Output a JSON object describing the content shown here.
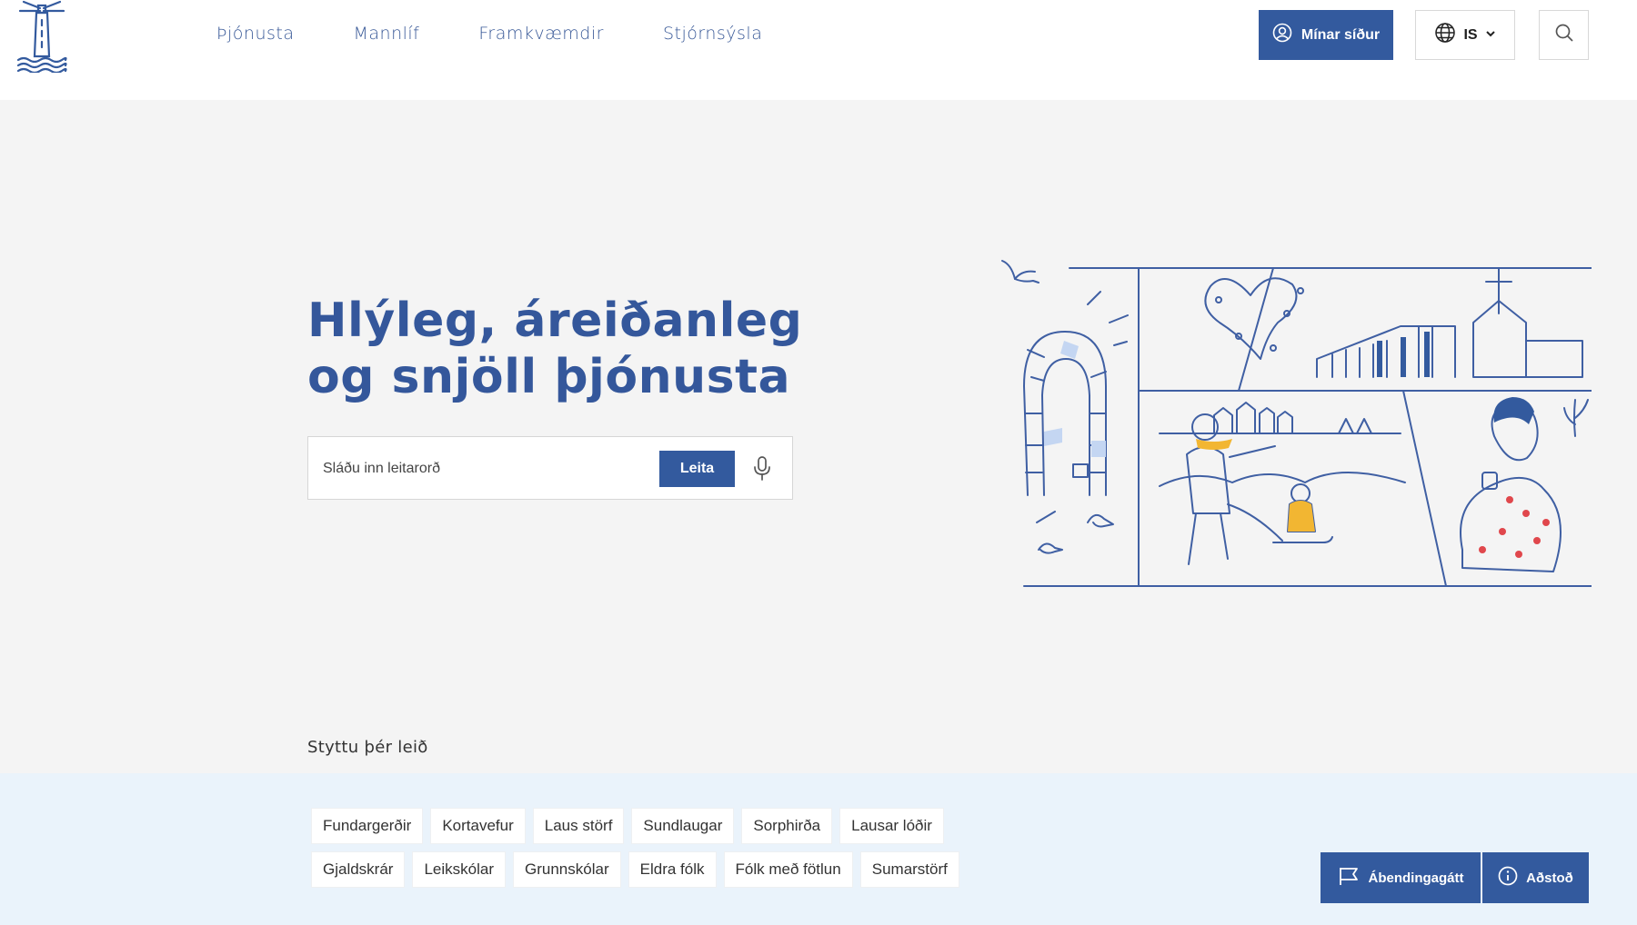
{
  "header": {
    "nav": [
      "Þjónusta",
      "Mannlíf",
      "Framkvæmdir",
      "Stjórnsýsla"
    ],
    "my_pages_label": "Mínar síður",
    "language_label": "IS",
    "icons": {
      "logo": "lighthouse-logo",
      "user": "user-icon",
      "globe": "globe-icon",
      "chevron": "chevron-down-icon",
      "search": "search-icon"
    }
  },
  "hero": {
    "title_line1": "Hlýleg, áreiðanleg",
    "title_line2": "og snjöll þjónusta",
    "search": {
      "placeholder": "Sláðu inn leitarorð",
      "value": "",
      "button_label": "Leita",
      "mic_icon": "microphone-icon"
    },
    "illustration": "town-life-illustration"
  },
  "shortcuts": {
    "title": "Styttu þér leið",
    "items": [
      "Fundargerðir",
      "Kortavefur",
      "Laus störf",
      "Sundlaugar",
      "Sorphirða",
      "Lausar lóðir",
      "Gjaldskrár",
      "Leikskólar",
      "Grunnskólar",
      "Eldra fólk",
      "Fólk með fötlun",
      "Sumarstörf"
    ]
  },
  "floating": {
    "feedback_label": "Ábendingagátt",
    "feedback_icon": "flag-icon",
    "help_label": "Aðstoð",
    "help_icon": "info-icon"
  },
  "colors": {
    "brand_blue": "#335a9e",
    "background": "#f4f4f4",
    "shortcut_band": "#eaf3fb",
    "accent_red": "#e0474c",
    "accent_yellow": "#f2b632"
  }
}
